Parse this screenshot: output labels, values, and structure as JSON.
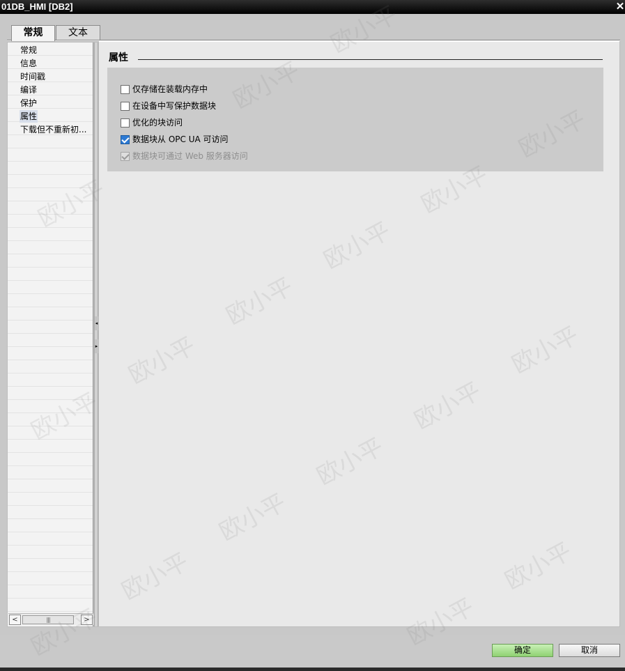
{
  "window": {
    "title": "01DB_HMI [DB2]",
    "close_glyph": "✕"
  },
  "tabs": [
    {
      "label": "常规",
      "active": true
    },
    {
      "label": "文本",
      "active": false
    }
  ],
  "nav": {
    "items": [
      {
        "label": "常规",
        "selected": false
      },
      {
        "label": "信息",
        "selected": false
      },
      {
        "label": "时间戳",
        "selected": false
      },
      {
        "label": "编译",
        "selected": false
      },
      {
        "label": "保护",
        "selected": false
      },
      {
        "label": "属性",
        "selected": true
      },
      {
        "label": "下载但不重新初..."
      }
    ],
    "scroll_left": "<",
    "scroll_right": ">",
    "scroll_thumb": "|||"
  },
  "splitter": {
    "collapse_glyph": "◂",
    "expand_glyph": "▸"
  },
  "section": {
    "title": "属性"
  },
  "options": [
    {
      "label": "仅存储在装载内存中",
      "checked": false,
      "enabled": true
    },
    {
      "label": "在设备中写保护数据块",
      "checked": false,
      "enabled": true
    },
    {
      "label": "优化的块访问",
      "checked": false,
      "enabled": true
    },
    {
      "label": "数据块从 OPC UA 可访问",
      "checked": true,
      "enabled": true
    },
    {
      "label": "数据块可通过 Web 服务器访问",
      "checked": true,
      "enabled": false
    }
  ],
  "footer": {
    "ok_label": "确定",
    "cancel_label": "取消"
  },
  "watermark": {
    "text": "欧小平"
  },
  "colors": {
    "checkbox_checked": "#2d7ad4",
    "ok_button": "#8fd272",
    "nav_selected": "#d7deea"
  }
}
